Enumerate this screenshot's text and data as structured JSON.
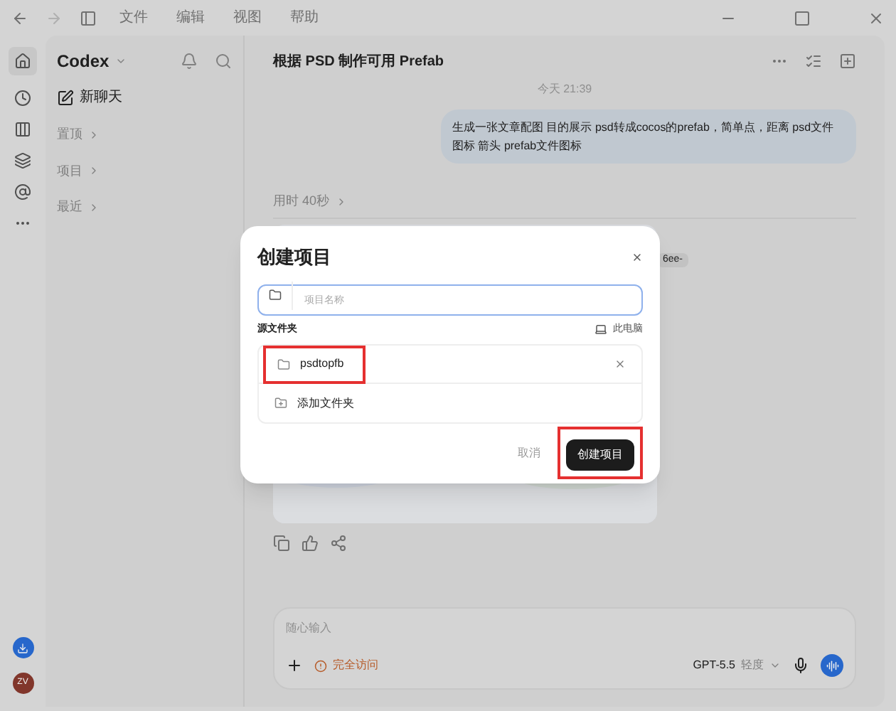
{
  "menu_bar": [
    "文件",
    "编辑",
    "视图",
    "帮助"
  ],
  "sidebar": {
    "app_name": "Codex",
    "new_chat": "新聊天",
    "sections": [
      "置顶",
      "项目",
      "最近"
    ],
    "avatar_initials": "ZV"
  },
  "thread": {
    "title": "根据 PSD 制作可用 Prefab",
    "timestamp": "今天 21:39",
    "user_message": "生成一张文章配图  目的展示  psd转成cocos的prefab，简单点，距离  psd文件图标 箭头 prefab文件图标",
    "elapsed": "用时 40秒",
    "chip": "6ee-"
  },
  "composer": {
    "placeholder": "随心输入",
    "access": "完全访问",
    "model": "GPT-5.5",
    "effort": "轻度"
  },
  "dialog": {
    "title": "创建项目",
    "name_field": {
      "placeholder": "项目名称"
    },
    "source_label": "源文件夹",
    "location": "此电脑",
    "folders": [
      {
        "name": "psdtopfb",
        "highlighted": true
      }
    ],
    "add_folder": "添加文件夹",
    "cancel": "取消",
    "create": "创建项目",
    "create_highlighted": true
  }
}
